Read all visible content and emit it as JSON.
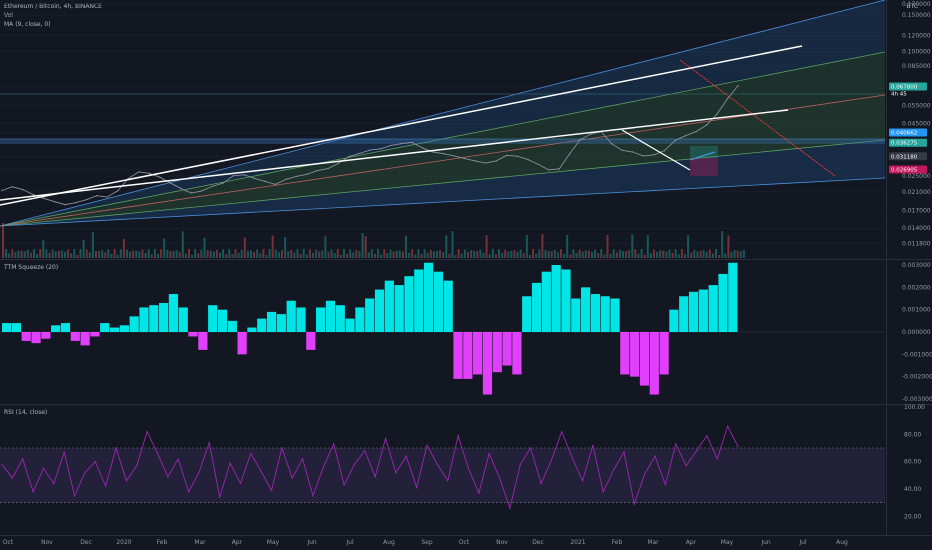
{
  "header": {
    "symbol_line": "Ethereum / Bitcoin, 4h, BINANCE",
    "vol_label": "Vol",
    "ma_label": "MA (9, close, 0)",
    "currency": "BTC"
  },
  "panels": {
    "ttm_label": "TTM Squeeze (20)",
    "rsi_label": "RSI (14, close)"
  },
  "colors": {
    "background": "#131722",
    "up_squeeze": "#00e5e5",
    "down_squeeze": "#e040fb",
    "rsi_line": "#9c27b0",
    "rsi_band": "#7e57c2",
    "price_line": "#8a8e99",
    "fan_blue": "#2962ff",
    "fan_green": "#4caf50",
    "trend_white": "#ffffff",
    "pitch_red": "#ef5350"
  },
  "badges": {
    "last_price": "0.067800",
    "last_sub": "4h 45",
    "level_1": "0.040662",
    "level_2": "0.036275",
    "level_3": "0.031180",
    "level_4": "0.026905"
  },
  "chart_data": [
    {
      "type": "line",
      "title": "Ethereum / Bitcoin, 4h, BINANCE",
      "y_scale": "log",
      "ylim": [
        0.0105,
        0.17
      ],
      "y_ticks": [
        "0.170000",
        "0.150000",
        "0.120000",
        "0.100000",
        "0.085000",
        "0.067800",
        "0.055000",
        "0.045000",
        "0.040662",
        "0.036275",
        "0.031180",
        "0.026905",
        "0.025000",
        "0.021000",
        "0.017000",
        "0.014000",
        "0.011800"
      ],
      "x_ticks": [
        "Oct",
        "Nov",
        "Dec",
        "2020",
        "Feb",
        "Mar",
        "Apr",
        "May",
        "Jun",
        "Jul",
        "Aug",
        "Sep",
        "Oct",
        "Nov",
        "Dec",
        "2021",
        "Feb",
        "Mar",
        "Apr",
        "May",
        "Jun",
        "Jul",
        "Aug"
      ],
      "series": [
        {
          "values": [
            0.0213,
            0.0222,
            0.0215,
            0.0203,
            0.0195,
            0.0188,
            0.0182,
            0.0186,
            0.0192,
            0.0201,
            0.0198,
            0.0212,
            0.0243,
            0.0262,
            0.0258,
            0.0247,
            0.0232,
            0.0218,
            0.0207,
            0.0212,
            0.0223,
            0.0231,
            0.0251,
            0.0254,
            0.0244,
            0.0236,
            0.0228,
            0.0241,
            0.0249,
            0.0255,
            0.0266,
            0.0272,
            0.0288,
            0.0311,
            0.0322,
            0.0334,
            0.0339,
            0.0352,
            0.0359,
            0.0364,
            0.0342,
            0.0327,
            0.0321,
            0.0313,
            0.0304,
            0.0296,
            0.0289,
            0.0296,
            0.0315,
            0.0312,
            0.0301,
            0.0285,
            0.0268,
            0.0271,
            0.0321,
            0.0376,
            0.0399,
            0.041,
            0.0358,
            0.0333,
            0.0327,
            0.0313,
            0.0317,
            0.0332,
            0.0371,
            0.0392,
            0.041,
            0.0441,
            0.0499,
            0.0592,
            0.0684
          ]
        }
      ]
    },
    {
      "type": "bar",
      "title": "TTM Squeeze (20)",
      "ylim": [
        -0.003,
        0.003
      ],
      "y_ticks": [
        "0.003000",
        "0.002000",
        "0.001000",
        "0.000000",
        "-0.001000",
        "-0.002000",
        "-0.003000"
      ],
      "series": [
        {
          "values": [
            0.0004,
            0.0004,
            -0.0004,
            -0.0005,
            -0.0003,
            0.0003,
            0.0004,
            -0.0004,
            -0.0006,
            -0.0002,
            0.0004,
            0.0002,
            0.0003,
            0.0007,
            0.0011,
            0.0012,
            0.0013,
            0.0017,
            0.0011,
            -0.0002,
            -0.0008,
            0.0012,
            0.001,
            0.0005,
            -0.001,
            0.0002,
            0.0006,
            0.0009,
            0.0008,
            0.0014,
            0.0011,
            -0.0008,
            0.0011,
            0.0014,
            0.0012,
            0.0006,
            0.0011,
            0.0015,
            0.0019,
            0.0023,
            0.0021,
            0.0025,
            0.0028,
            0.0031,
            0.0027,
            0.0023,
            -0.0021,
            -0.0021,
            -0.0019,
            -0.0028,
            -0.0018,
            -0.0015,
            -0.0019,
            0.0016,
            0.0022,
            0.0027,
            0.003,
            0.0028,
            0.0015,
            0.002,
            0.0017,
            0.0016,
            0.0015,
            -0.0019,
            -0.002,
            -0.0024,
            -0.0028,
            -0.0019,
            0.001,
            0.0016,
            0.0018,
            0.0019,
            0.0021,
            0.0026,
            0.0031
          ]
        }
      ]
    },
    {
      "type": "line",
      "title": "RSI (14, close)",
      "ylim": [
        10,
        100
      ],
      "y_ticks": [
        "100.00",
        "80.00",
        "60.00",
        "40.00",
        "20.00"
      ],
      "band": [
        30,
        70
      ],
      "series": [
        {
          "values": [
            58,
            48,
            62,
            38,
            55,
            44,
            67,
            35,
            52,
            60,
            42,
            70,
            46,
            57,
            82,
            66,
            49,
            62,
            38,
            52,
            74,
            34,
            59,
            44,
            66,
            53,
            39,
            70,
            48,
            62,
            35,
            56,
            73,
            43,
            58,
            68,
            49,
            77,
            52,
            64,
            41,
            72,
            58,
            46,
            79,
            55,
            37,
            66,
            48,
            26,
            58,
            70,
            44,
            61,
            82,
            63,
            46,
            72,
            38,
            54,
            67,
            29,
            51,
            64,
            43,
            73,
            57,
            68,
            79,
            62,
            86,
            71
          ]
        }
      ]
    }
  ]
}
